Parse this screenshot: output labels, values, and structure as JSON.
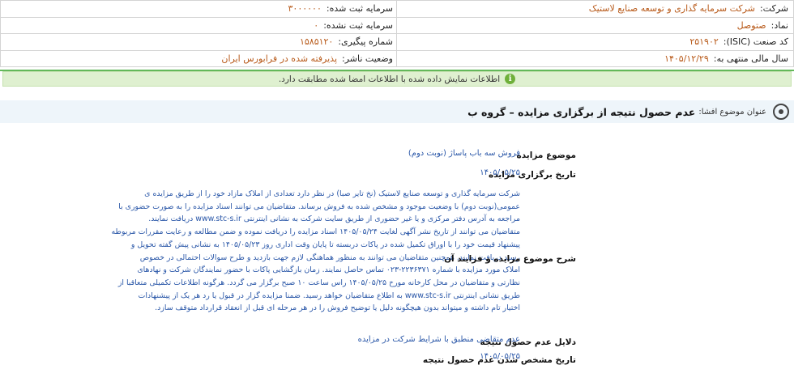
{
  "company": {
    "company_label": "شرکت:",
    "company_name": "شرکت سرمایه گذاری و توسعه صنایع لاستیک",
    "registered_capital_label": "سرمایه ثبت شده:",
    "registered_capital": "۳۰۰۰۰۰۰",
    "symbol_label": "نماد:",
    "symbol": "صتوصل",
    "unregistered_capital_label": "سرمایه ثبت نشده:",
    "unregistered_capital": "۰",
    "isic_label": "کد صنعت (ISIC):",
    "isic": "۲۵۱۹۰۲",
    "tracking_label": "شماره پیگیری:",
    "tracking": "۱۵۸۵۱۲۰",
    "fiscal_year_label": "سال مالی منتهی به:",
    "fiscal_year": "۱۴۰۵/۱۲/۲۹",
    "publisher_status_label": "وضعیت ناشر:",
    "publisher_status": "پذیرفته شده در فرابورس ایران"
  },
  "notice": {
    "text": "اطلاعات نمایش داده شده با اطلاعات امضا شده مطابقت دارد.",
    "icon": "info-icon"
  },
  "title": {
    "prefix": "عنوان موضوع افشا:",
    "text": "عدم حصول نتیجه از برگزاری مزایده – گروه ب",
    "icon": "target-icon"
  },
  "details": {
    "subject_label": "موضوع مزایده",
    "subject_value": "فروش سه باب پاساژ (نوبت دوم)",
    "date_label": "تاریخ برگزاری مزایده",
    "date_value": "۱۴۰۵/۰۵/۲۵",
    "description_label": "شرح موضوع مزایده و فرایند آن",
    "description_lines": [
      "شرکت سرمایه گذاری و توسعه صنایع لاستیک (نخ تایر صبا) در نظر دارد تعدادی از املاک مازاد خود را از طریق مزایده ی",
      "عمومی(نوبت دوم) با وضعیت موجود و مشخص شده به فروش برساند. متقاضیان می توانند اسناد مزایده را به صورت حضوری با",
      "مراجعه به آدرس دفتر مرکزی و یا غیر حضوری از طریق سایت شرکت به نشانی اینترنتی www.stc-s.ir دریافت نمایند.",
      "متقاضیان می توانند از تاریخ نشر آگهی لغایت ۱۴۰۵/۰۵/۲۴ اسناد مزایده را دریافت نموده و ضمن مطالعه و رعایت مقررات مربوطه",
      "پیشنهاد قیمت خود را با اوراق تکمیل شده در پاکات دربسته تا پایان وقت اداری روز ۱۴۰۵/۰۵/۲۳ به نشانی پیش گفته تحویل و",
      "رسید دریافت نمایند. همچنین متقاضیان می توانند به منظور هماهنگی لازم جهت بازدید و طرح سوالات احتمالی در خصوص",
      "املاک مورد مزایده با شماره ۲۲۳۶۳۷۱-۰۲۳ تماس حاصل نمایند. زمان بازگشایی پاکات با حضور نمایندگان شرکت و نهادهای",
      "نظارتی و متقاضیان در محل کارخانه مورخ ۱۴۰۵/۰۵/۲۵ راس ساعت ۱۰ صبح برگزار می گردد. هرگونه اطلاعات تکمیلی متعاقبا از",
      "طریق نشانی اینترنتی www.stc-s.ir به اطلاع متقاضیان خواهد رسید. ضمنا مزایده گزار در قبول یا رد هر یک از پیشنهادات",
      "اختیار تام داشته و میتواند بدون هیچگونه دلیل یا توضیح فروش را در هر مرحله ای قبل از انعقاد قرارداد متوقف سازد."
    ],
    "reason_label": "دلایل عدم حصول نتیجه",
    "reason_value": "عدم متقاضی منطبق با شرایط شرکت در مزایده",
    "fail_date_label": "تاریخ مشخص شدن عدم حصول نتیجه",
    "fail_date_value": "۱۴۰۵/۰۵/۲۵"
  },
  "colors": {
    "value_orange": "#b85a1a",
    "link_blue": "#2a57a8",
    "notice_green": "#dff0d0",
    "title_bar": "#eef5fa"
  }
}
